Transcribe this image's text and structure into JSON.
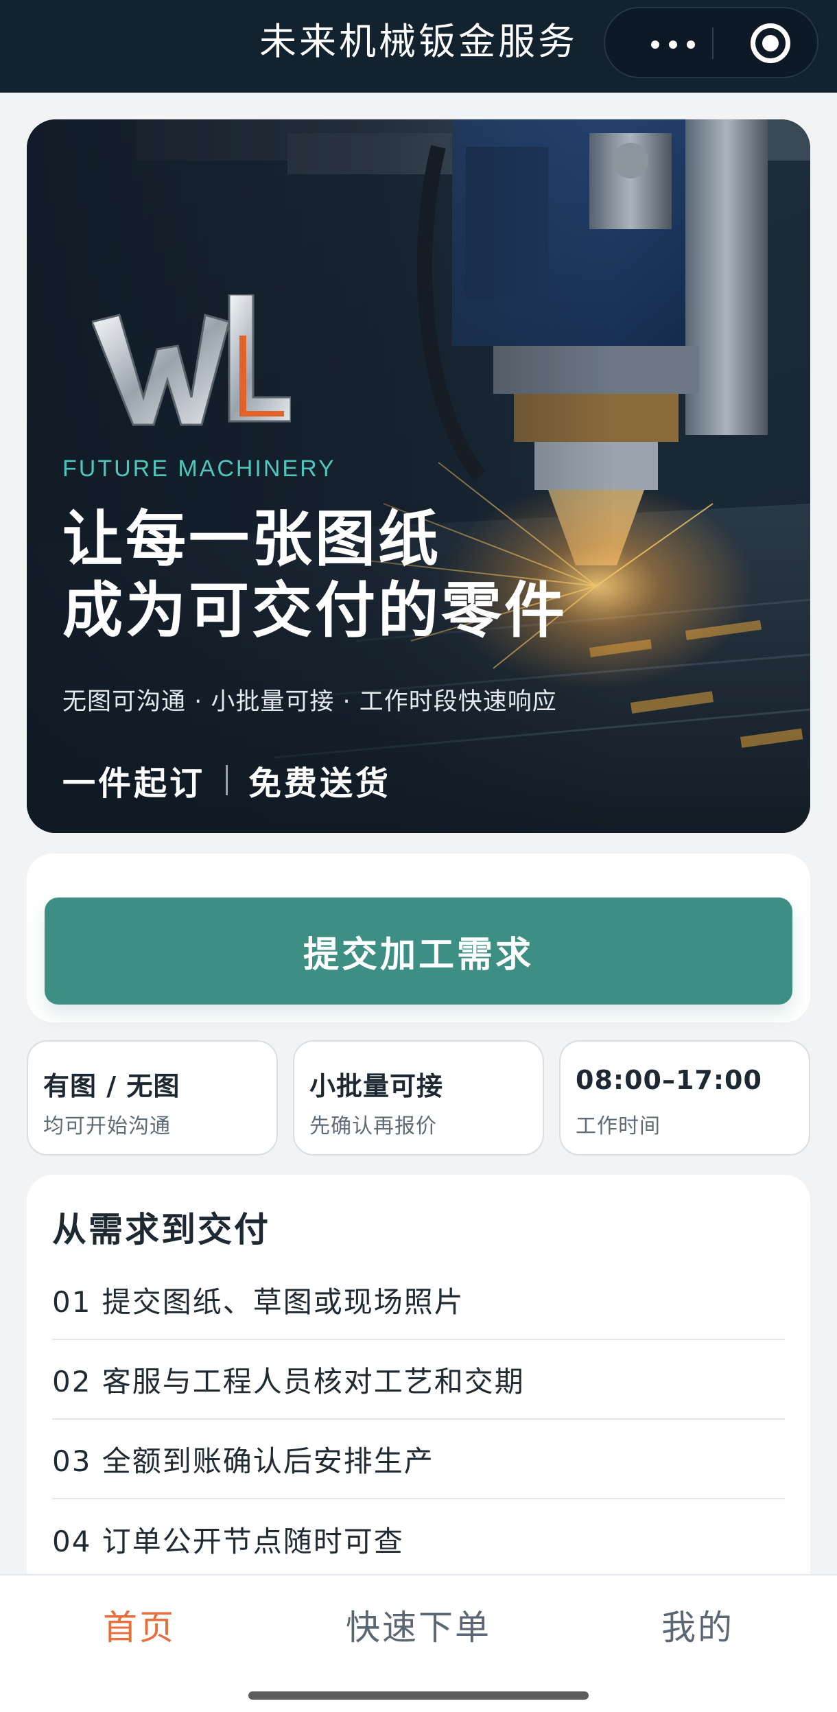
{
  "navbar": {
    "title": "未来机械钣金服务",
    "more_icon": "more-dots-icon",
    "close_icon": "target-circle-icon"
  },
  "hero": {
    "logo_text": "WL",
    "tagline_en": "FUTURE MACHINERY",
    "headline_line1": "让每一张图纸",
    "headline_line2": "成为可交付的零件",
    "subtitle": "无图可沟通 · 小批量可接 · 工作时段快速响应",
    "badge_left": "一件起订",
    "badge_right": "免费送货"
  },
  "action": {
    "submit_label": "提交加工需求"
  },
  "features": [
    {
      "title": "有图 / 无图",
      "subtitle": "均可开始沟通"
    },
    {
      "title": "小批量可接",
      "subtitle": "先确认再报价"
    },
    {
      "title": "08:00–17:00",
      "subtitle": "工作时间"
    }
  ],
  "process": {
    "title": "从需求到交付",
    "steps": [
      "01 提交图纸、草图或现场照片",
      "02 客服与工程人员核对工艺和交期",
      "03 全额到账确认后安排生产",
      "04 订单公开节点随时可查"
    ]
  },
  "tabbar": {
    "items": [
      {
        "label": "首页",
        "active": true
      },
      {
        "label": "快速下单",
        "active": false
      },
      {
        "label": "我的",
        "active": false
      }
    ]
  },
  "colors": {
    "nav_bg": "#13222f",
    "accent_teal": "#3d8f84",
    "tagline_teal": "#4ec6bb",
    "tab_active": "#e86f3c"
  }
}
